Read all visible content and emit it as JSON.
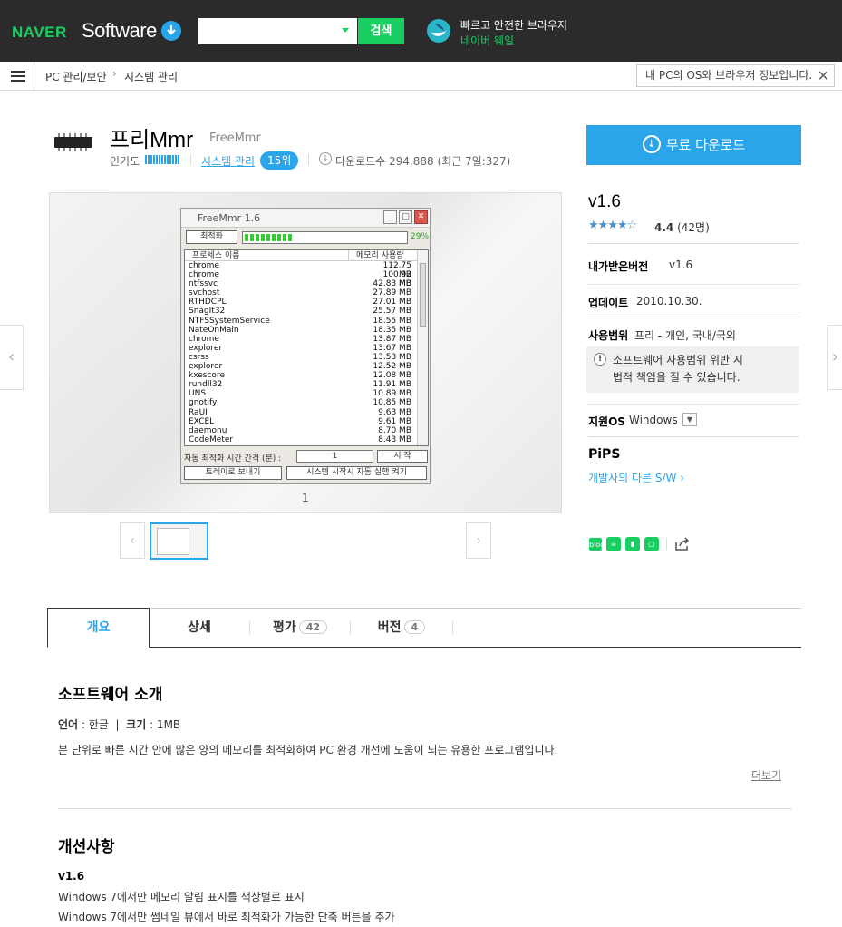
{
  "header": {
    "naver": "NAVER",
    "software": "Software",
    "search_placeholder": "",
    "search_button": "검색",
    "whale_line1": "빠르고 안전한 브라우저",
    "whale_line2": "네이버 웨일"
  },
  "breadcrumb": {
    "level1": "PC 관리/보안",
    "sep": "›",
    "level2": "시스템 관리"
  },
  "os_info": "내 PC의 OS와 브라우저 정보입니다.",
  "app": {
    "title": "프리Mmr",
    "title_en": "FreeMmr",
    "popularity_label": "인기도",
    "category": "시스템 관리",
    "rank": "15위",
    "downloads": "다운로드수 294,888 (최근 7일:327)",
    "download_button": "무료 다운로드"
  },
  "screenshot": {
    "window_title": "FreeMmr 1.6",
    "optimize_button": "최적화",
    "progress_percent": "29%",
    "progress_value": 0.29,
    "col_process": "프로세스 이름",
    "col_memory": "메모리 사용량",
    "processes": [
      {
        "name": "chrome",
        "mem": "112.75 MB"
      },
      {
        "name": "chrome",
        "mem": "100.92 MB"
      },
      {
        "name": "ntfssvc",
        "mem": "42.83 MB"
      },
      {
        "name": "svchost",
        "mem": "27.89 MB"
      },
      {
        "name": "RTHDCPL",
        "mem": "27.01 MB"
      },
      {
        "name": "SnagIt32",
        "mem": "25.57 MB"
      },
      {
        "name": "NTFSSystemService",
        "mem": "18.55 MB"
      },
      {
        "name": "NateOnMain",
        "mem": "18.35 MB"
      },
      {
        "name": "chrome",
        "mem": "13.87 MB"
      },
      {
        "name": "explorer",
        "mem": "13.67 MB"
      },
      {
        "name": "csrss",
        "mem": "13.53 MB"
      },
      {
        "name": "explorer",
        "mem": "12.52 MB"
      },
      {
        "name": "kxescore",
        "mem": "12.08 MB"
      },
      {
        "name": "rundll32",
        "mem": "11.91 MB"
      },
      {
        "name": "UNS",
        "mem": "10.89 MB"
      },
      {
        "name": "gnotify",
        "mem": "10.85 MB"
      },
      {
        "name": "RaUI",
        "mem": "9.63 MB"
      },
      {
        "name": "EXCEL",
        "mem": "9.61 MB"
      },
      {
        "name": "daemonu",
        "mem": "8.70 MB"
      },
      {
        "name": "CodeMeter",
        "mem": "8.43 MB"
      }
    ],
    "interval_label": "자동 최적화 시간 간격 (분) :",
    "interval_value": "1",
    "start_button": "시 작",
    "tray_button": "트레이로 보내기",
    "autostart_button": "시스템 시작시 자동 실행 켜기",
    "page": "1"
  },
  "info": {
    "version": "v1.6",
    "stars": "★★★★☆",
    "rating": "4.4",
    "rating_count": "(42명)",
    "received_label": "내가받은버전",
    "received_value": "v1.6",
    "update_label": "업데이트",
    "update_value": "2010.10.30.",
    "scope_label": "사용범위",
    "scope_value": "프리 - 개인, 국내/국외",
    "notice_line1": "소프트웨어 사용범위 위반 시",
    "notice_line2": "법적 책임을 질 수 있습니다.",
    "os_label": "지원OS",
    "os_value": "Windows",
    "developer": "PiPS",
    "developer_link": "개발사의 다른 S/W ›"
  },
  "tabs": [
    {
      "label": "개요"
    },
    {
      "label": "상세"
    },
    {
      "label": "평가",
      "count": "42"
    },
    {
      "label": "버전",
      "count": "4"
    }
  ],
  "overview": {
    "heading": "소프트웨어 소개",
    "lang_label": "언어",
    "lang_value": " : 한글",
    "size_label": "크기",
    "size_value": " : 1MB",
    "description": "분 단위로 빠른 시간 안에 많은 양의 메모리를 최적화하여 PC 환경 개선에 도움이 되는 유용한 프로그램입니다.",
    "more": "더보기"
  },
  "changes": {
    "heading": "개선사항",
    "version": "v1.6",
    "items": [
      "Windows 7에서만 메모리 알림 표시를 색상별로 표시",
      "Windows 7에서만 썸네일 뷰에서 바로 최적화가 가능한 단축 버튼을 추가"
    ]
  },
  "colors": {
    "accent": "#2aa5ea",
    "naver_green": "#19ce60",
    "topbar": "#2b2b2b"
  }
}
